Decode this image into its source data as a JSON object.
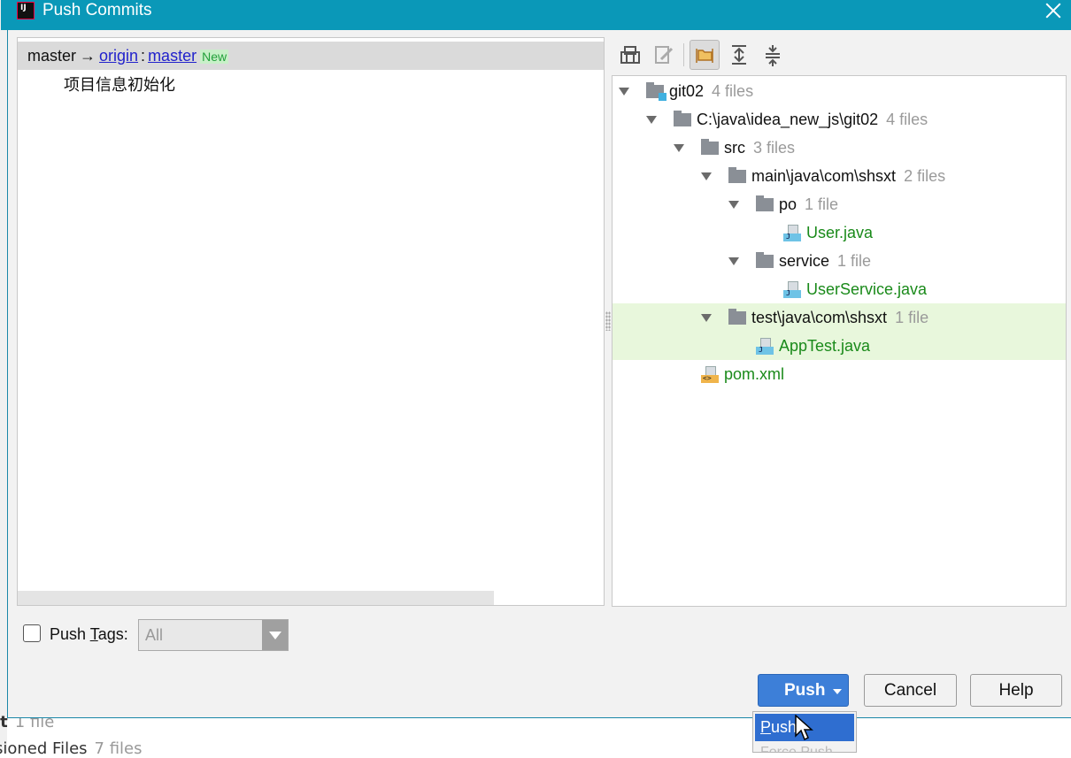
{
  "dialog": {
    "title": "Push Commits",
    "app_icon_text": "IJ"
  },
  "commits": {
    "local_branch": "master",
    "arrow": "→",
    "remote": "origin",
    "separator": ":",
    "remote_branch": "master",
    "new_tag": "New",
    "messages": [
      "项目信息初始化"
    ]
  },
  "toolbar": {
    "icons": [
      "show-diff-icon",
      "edit-source-icon",
      "group-by-directory-icon",
      "expand-all-icon",
      "collapse-all-icon"
    ],
    "active": "group-by-directory-icon"
  },
  "tree": {
    "rows": [
      {
        "name": "git02",
        "count": "4 files"
      },
      {
        "name": "C:\\java\\idea_new_js\\git02",
        "count": "4 files"
      },
      {
        "name": "src",
        "count": "3 files"
      },
      {
        "name": "main\\java\\com\\shsxt",
        "count": "2 files"
      },
      {
        "name": "po",
        "count": "1 file"
      },
      {
        "name": "User.java"
      },
      {
        "name": "service",
        "count": "1 file"
      },
      {
        "name": "UserService.java"
      },
      {
        "name": "test\\java\\com\\shsxt",
        "count": "1 file"
      },
      {
        "name": "AppTest.java"
      },
      {
        "name": "pom.xml"
      }
    ],
    "modified_color": "#1a8a1a",
    "highlight_color": "#e8f7dc"
  },
  "push_tags": {
    "label_pre": "Push ",
    "label_mnemonic": "T",
    "label_post": "ags:",
    "checked": false,
    "select_value": "All"
  },
  "buttons": {
    "push": "Push",
    "cancel": "Cancel",
    "help": "Help"
  },
  "push_menu": {
    "item_mnemonic": "P",
    "item_rest": "ush",
    "item_2": "Force Push"
  },
  "background": {
    "item_1_bold": "it",
    "item_1_count": "1 file",
    "item_2": "sioned Files",
    "item_2_count": "7 files"
  },
  "colors": {
    "titlebar": "#0a98b8",
    "push_button": "#3d7fd8",
    "link": "#2222cc"
  }
}
